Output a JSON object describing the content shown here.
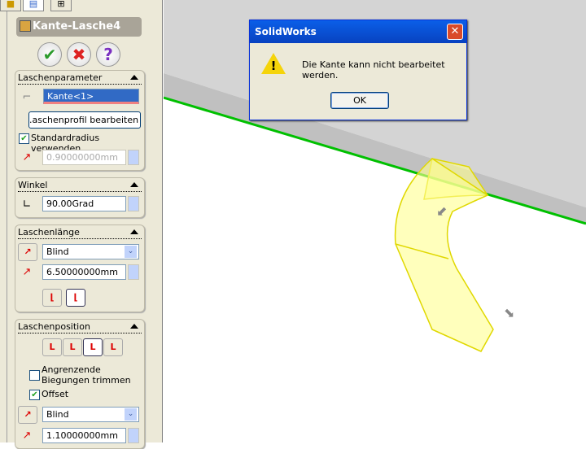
{
  "panel": {
    "title": "Kante-Lasche4",
    "laschenparameter": {
      "header": "Laschenparameter",
      "edge_value": "Kante<1>",
      "edit_profile_button": ".aschenprofil bearbeiten",
      "use_default_radius": "Standardradius verwenden",
      "radius": "0.90000000mm"
    },
    "winkel": {
      "header": "Winkel",
      "value": "90.00Grad"
    },
    "laschenlaenge": {
      "header": "Laschenlänge",
      "end_condition": "Blind",
      "length": "6.50000000mm"
    },
    "laschenposition": {
      "header": "Laschenposition",
      "trim_label": "Angrenzende Biegungen trimmen",
      "offset_label": "Offset",
      "offset_condition": "Blind",
      "offset_value": "1.10000000mm"
    }
  },
  "dialog": {
    "title": "SolidWorks",
    "message": "Die Kante kann nicht bearbeitet werden.",
    "ok": "OK",
    "close": "✕"
  },
  "colors": {
    "edge_highlight": "#00c000",
    "flange_preview": "#ffff80"
  }
}
